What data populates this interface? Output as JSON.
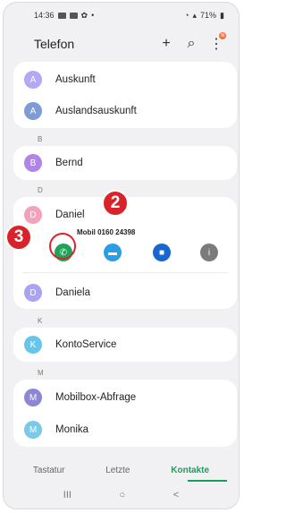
{
  "status": {
    "time": "14:36",
    "battery": "71%"
  },
  "header": {
    "title": "Telefon",
    "menu_badge": "N"
  },
  "contacts": [
    {
      "letter": "A",
      "name": "Auskunft",
      "color": "#b4a7f6"
    },
    {
      "letter": "A",
      "name": "Auslandsauskunft",
      "color": "#7e9bd8"
    },
    {
      "letter": "B",
      "name": "Bernd",
      "color": "#b084e9"
    },
    {
      "letter": "D",
      "name": "Daniel",
      "color": "#f2a3bb",
      "detail": "Mobil 0160 24398"
    },
    {
      "letter": "D",
      "name": "Daniela",
      "color": "#a9a3f0"
    },
    {
      "letter": "K",
      "name": "KontoService",
      "color": "#67c5ea"
    },
    {
      "letter": "M",
      "name": "Mobilbox-Abfrage",
      "color": "#8c86d4"
    },
    {
      "letter": "M",
      "name": "Monika",
      "color": "#79c9e9"
    }
  ],
  "sections": [
    "B",
    "D",
    "K",
    "M"
  ],
  "actions": [
    {
      "icon": "call-icon",
      "color": "#1fa35a"
    },
    {
      "icon": "message-icon",
      "color": "#2a9de3"
    },
    {
      "icon": "video-icon",
      "color": "#1a66d1"
    },
    {
      "icon": "info-icon",
      "color": "#7b7b7b"
    }
  ],
  "annotations": {
    "step2": "2",
    "step3": "3"
  },
  "tabs": [
    "Tastatur",
    "Letzte",
    "Kontakte"
  ],
  "navbar": {
    "recents": "III",
    "home": "○",
    "back": "<"
  }
}
